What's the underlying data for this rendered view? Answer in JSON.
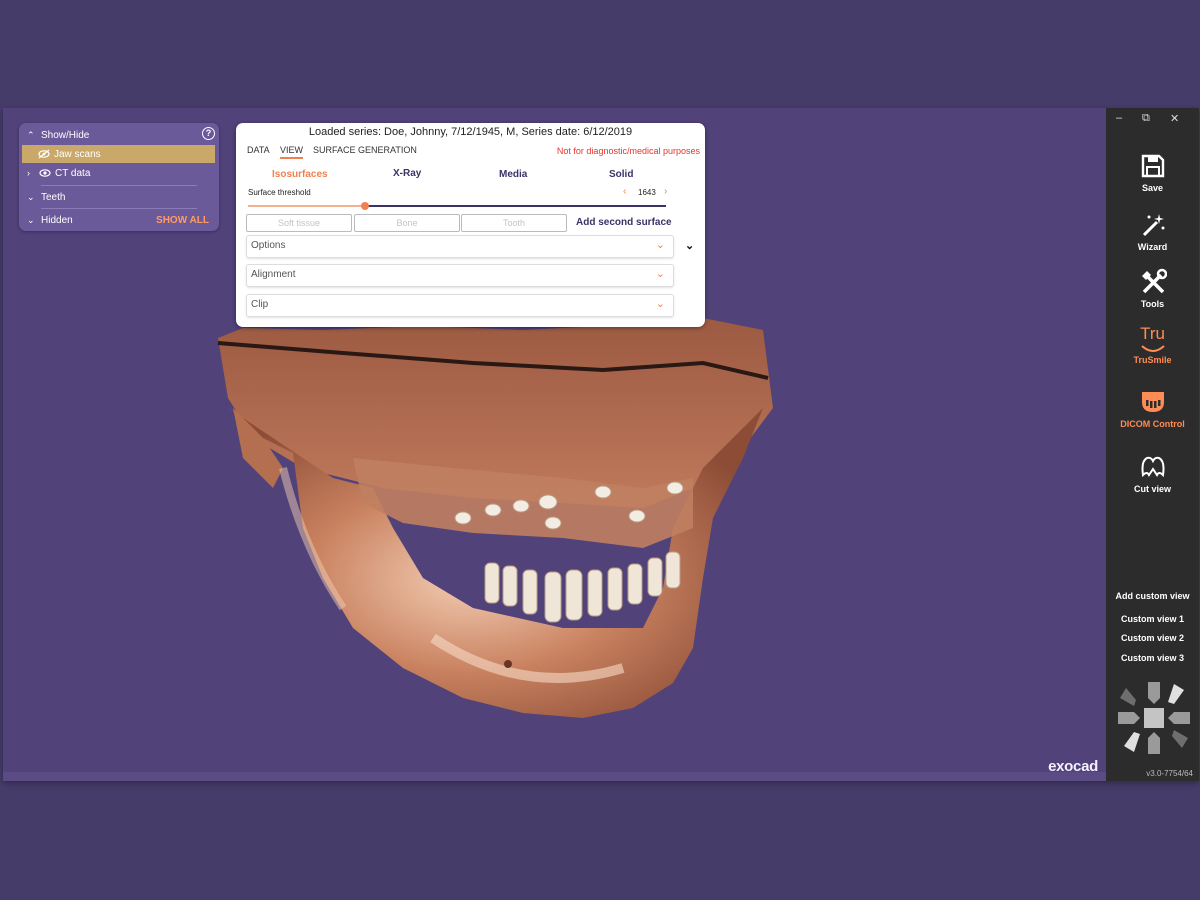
{
  "show_hide": {
    "title": "Show/Hide",
    "items": [
      "Jaw scans",
      "CT data",
      "Teeth",
      "Hidden"
    ],
    "show_all": "SHOW ALL"
  },
  "view_dialog": {
    "title": "Loaded series: Doe, Johnny, 7/12/1945, M, Series date: 6/12/2019",
    "tabs": [
      "DATA",
      "VIEW",
      "SURFACE GENERATION"
    ],
    "active_tab": "VIEW",
    "warning": "Not for diagnostic/medical purposes",
    "modes": [
      "Isosurfaces",
      "X-Ray",
      "Media",
      "Solid"
    ],
    "active_mode": "Isosurfaces",
    "threshold_label": "Surface threshold",
    "threshold_value": "1643",
    "threshold_fraction": 0.28,
    "surface_buttons": [
      "Soft tissue",
      "Bone",
      "Tooth"
    ],
    "add_second_surface": "Add second surface",
    "accordions": [
      "Options",
      "Alignment",
      "Clip"
    ]
  },
  "sidebar": {
    "tools": [
      {
        "label": "Save",
        "icon": "save-icon"
      },
      {
        "label": "Wizard",
        "icon": "wizard-icon"
      },
      {
        "label": "Tools",
        "icon": "tools-icon"
      },
      {
        "label": "TruSmile",
        "icon": "trusmile-icon"
      },
      {
        "label": "DICOM Control",
        "icon": "dicom-control-icon"
      },
      {
        "label": "Cut view",
        "icon": "cut-view-icon"
      }
    ],
    "trusmile_logo_text": "Tru",
    "add_custom_view": "Add custom view",
    "custom_views": [
      "Custom view 1",
      "Custom view 2",
      "Custom view 3"
    ],
    "version": "v3.0-7754/64"
  },
  "brand": "exocad",
  "colors": {
    "accent": "#f08050",
    "background": "#51427a",
    "sidebar": "#2c2c2c",
    "warning": "#e8312a"
  }
}
